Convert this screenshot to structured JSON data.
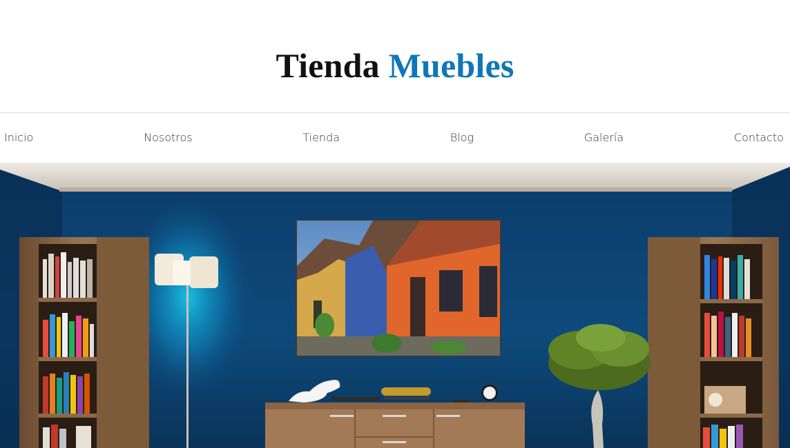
{
  "header": {
    "brand_main": "Tienda",
    "brand_accent": "Muebles",
    "accent_color": "#0f77b9"
  },
  "nav": {
    "items": [
      "Inicio",
      "Nosotros",
      "Tienda",
      "Blog",
      "Galería",
      "Contacto"
    ]
  },
  "hero": {
    "image": "blue-living-room-with-painting-lamp-bookshelves-sideboard"
  }
}
